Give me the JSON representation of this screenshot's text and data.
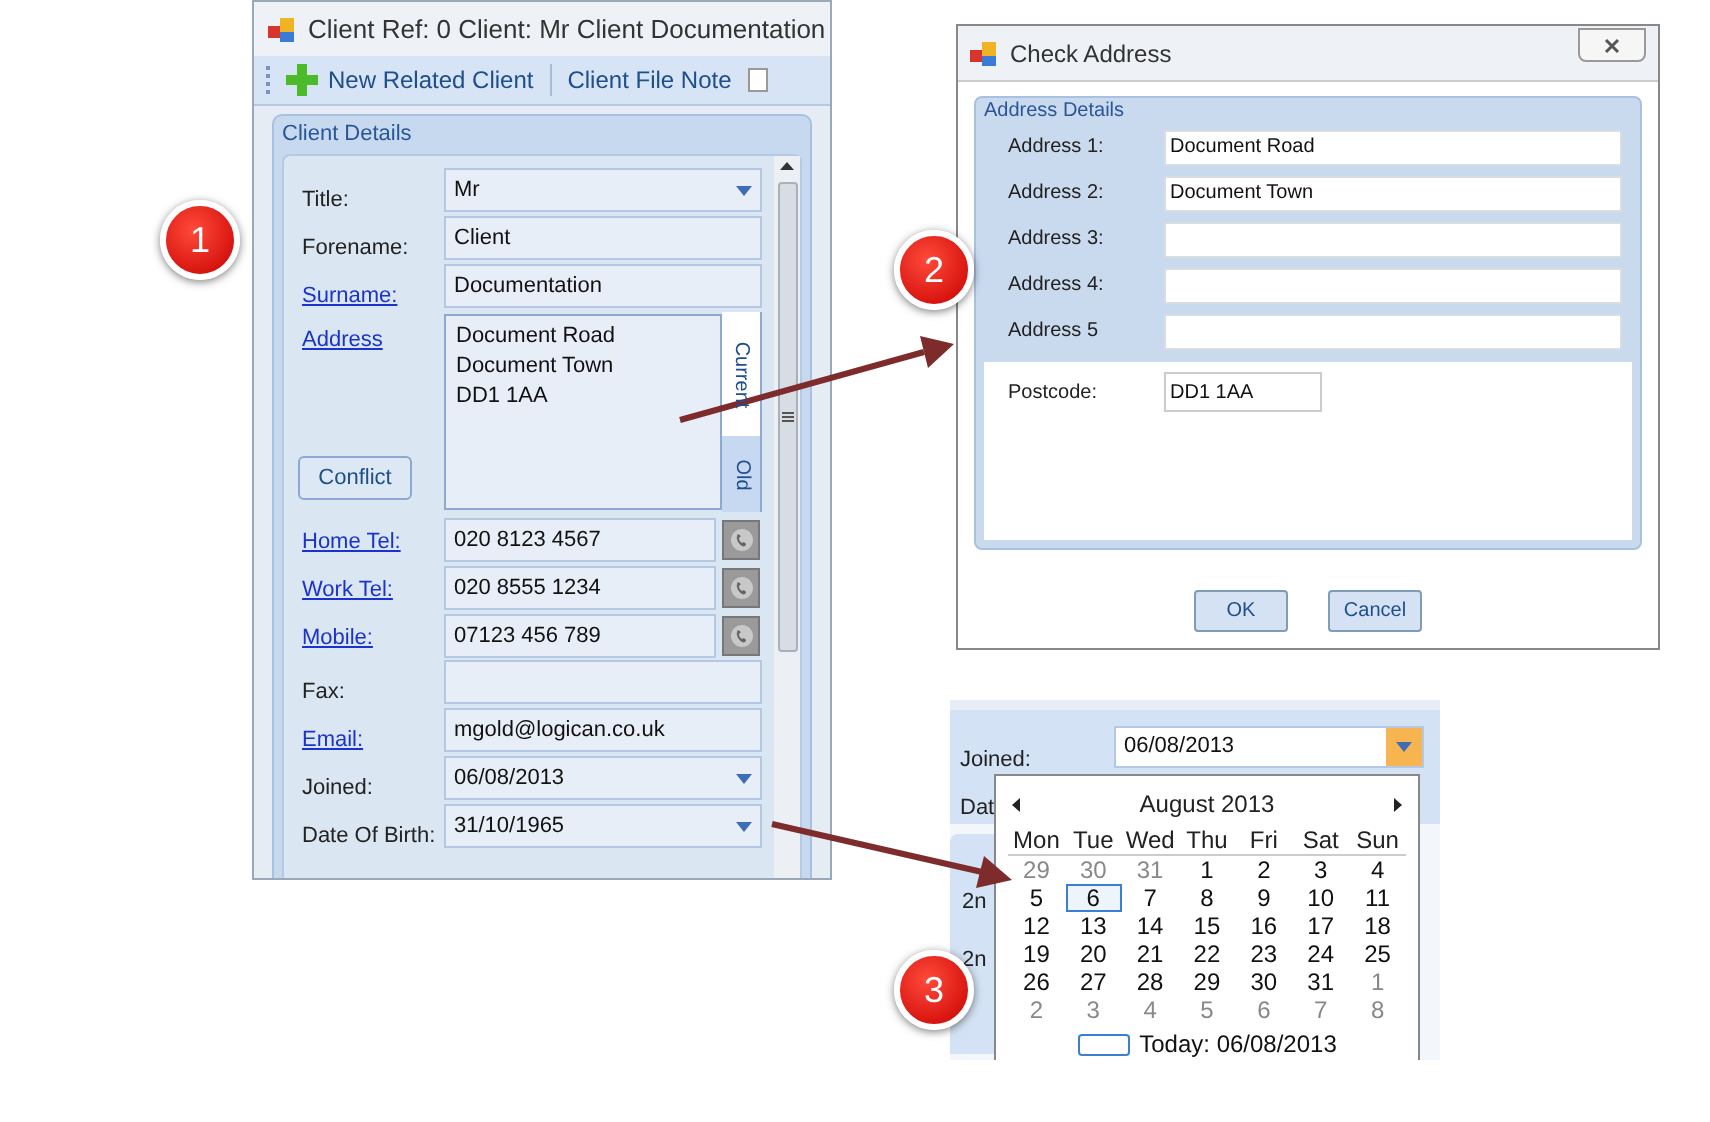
{
  "client_window": {
    "title": "Client Ref: 0 Client: Mr Client Documentation",
    "toolbar": [
      {
        "label": "New Related Client",
        "kind": "add"
      },
      {
        "label": "Client File Note",
        "kind": "plain"
      }
    ],
    "toolbar_checkbox": {
      "checked": false
    },
    "panel_title": "Client Details",
    "fields": [
      {
        "kind": "dropdown",
        "label": "Title:",
        "link": false,
        "value": "Mr"
      },
      {
        "kind": "text",
        "label": "Forename:",
        "link": false,
        "value": "Client"
      },
      {
        "kind": "text",
        "label": "Surname:",
        "link": true,
        "value": "Documentation"
      },
      {
        "kind": "address",
        "label": "Address",
        "link": true,
        "lines": [
          "Document Road",
          "Document Town",
          "DD1 1AA"
        ],
        "tabs": [
          {
            "label": "Current",
            "selected": true
          },
          {
            "label": "Old",
            "selected": false
          }
        ],
        "button": "Conflict"
      },
      {
        "kind": "phone",
        "label": "Home Tel:",
        "link": true,
        "value": "020 8123 4567"
      },
      {
        "kind": "phone",
        "label": "Work Tel:",
        "link": true,
        "value": "020 8555 1234"
      },
      {
        "kind": "phone",
        "label": "Mobile:",
        "link": true,
        "value": "07123 456 789"
      },
      {
        "kind": "text",
        "label": "Fax:",
        "link": false
      },
      {
        "kind": "text",
        "label": "Email:",
        "link": true,
        "value": "mgold@logican.co.uk"
      },
      {
        "kind": "dropdown",
        "label": "Joined:",
        "link": false,
        "value": "06/08/2013"
      },
      {
        "kind": "dropdown",
        "label": "Date Of Birth:",
        "link": false,
        "value": "31/10/1965"
      }
    ]
  },
  "check_window": {
    "title": "Check Address",
    "group_title": "Address Details",
    "rows": [
      {
        "label": "Address 1:",
        "value": "Document Road"
      },
      {
        "label": "Address 2:",
        "value": "Document Town"
      },
      {
        "label": "Address 3:"
      },
      {
        "label": "Address 4:"
      },
      {
        "label": "Address 5"
      }
    ],
    "postcode": {
      "label": "Postcode:",
      "value": "DD1 1AA"
    },
    "buttons": [
      "OK",
      "Cancel"
    ]
  },
  "calendar_window": {
    "field": {
      "label": "Joined:",
      "value": "06/08/2013"
    },
    "hidden_labels": [
      "Dat",
      "2n",
      "2n"
    ],
    "calendar": {
      "month": "August 2013",
      "weekdays": [
        "Mon",
        "Tue",
        "Wed",
        "Thu",
        "Fri",
        "Sat",
        "Sun"
      ],
      "weeks": [
        [
          {
            "day": "29",
            "muted": true,
            "selected": false
          },
          {
            "day": "30",
            "muted": true,
            "selected": false
          },
          {
            "day": "31",
            "muted": true,
            "selected": false
          },
          {
            "day": "1",
            "muted": false,
            "selected": false
          },
          {
            "day": "2",
            "muted": false,
            "selected": false
          },
          {
            "day": "3",
            "muted": false,
            "selected": false
          },
          {
            "day": "4",
            "muted": false,
            "selected": false
          }
        ],
        [
          {
            "day": "5",
            "muted": false,
            "selected": false
          },
          {
            "day": "6",
            "muted": false,
            "selected": true
          },
          {
            "day": "7",
            "muted": false,
            "selected": false
          },
          {
            "day": "8",
            "muted": false,
            "selected": false
          },
          {
            "day": "9",
            "muted": false,
            "selected": false
          },
          {
            "day": "10",
            "muted": false,
            "selected": false
          },
          {
            "day": "11",
            "muted": false,
            "selected": false
          }
        ],
        [
          {
            "day": "12",
            "muted": false,
            "selected": false
          },
          {
            "day": "13",
            "muted": false,
            "selected": false
          },
          {
            "day": "14",
            "muted": false,
            "selected": false
          },
          {
            "day": "15",
            "muted": false,
            "selected": false
          },
          {
            "day": "16",
            "muted": false,
            "selected": false
          },
          {
            "day": "17",
            "muted": false,
            "selected": false
          },
          {
            "day": "18",
            "muted": false,
            "selected": false
          }
        ],
        [
          {
            "day": "19",
            "muted": false,
            "selected": false
          },
          {
            "day": "20",
            "muted": false,
            "selected": false
          },
          {
            "day": "21",
            "muted": false,
            "selected": false
          },
          {
            "day": "22",
            "muted": false,
            "selected": false
          },
          {
            "day": "23",
            "muted": false,
            "selected": false
          },
          {
            "day": "24",
            "muted": false,
            "selected": false
          },
          {
            "day": "25",
            "muted": false,
            "selected": false
          }
        ],
        [
          {
            "day": "26",
            "muted": false,
            "selected": false
          },
          {
            "day": "27",
            "muted": false,
            "selected": false
          },
          {
            "day": "28",
            "muted": false,
            "selected": false
          },
          {
            "day": "29",
            "muted": false,
            "selected": false
          },
          {
            "day": "30",
            "muted": false,
            "selected": false
          },
          {
            "day": "31",
            "muted": false,
            "selected": false
          },
          {
            "day": "1",
            "muted": true,
            "selected": false
          }
        ],
        [
          {
            "day": "2",
            "muted": true,
            "selected": false
          },
          {
            "day": "3",
            "muted": true,
            "selected": false
          },
          {
            "day": "4",
            "muted": true,
            "selected": false
          },
          {
            "day": "5",
            "muted": true,
            "selected": false
          },
          {
            "day": "6",
            "muted": true,
            "selected": false
          },
          {
            "day": "7",
            "muted": true,
            "selected": false
          },
          {
            "day": "8",
            "muted": true,
            "selected": false
          }
        ]
      ],
      "today": "Today: 06/08/2013"
    }
  },
  "callouts": [
    "1",
    "2",
    "3"
  ]
}
